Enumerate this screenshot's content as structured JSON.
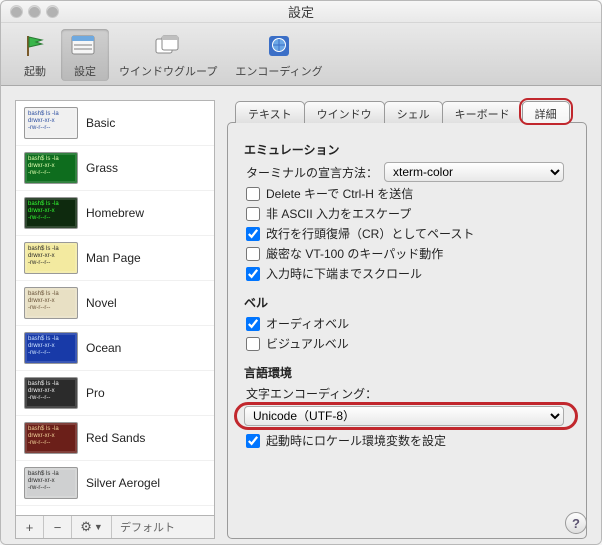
{
  "window": {
    "title": "設定"
  },
  "toolbar": {
    "items": [
      {
        "label": "起動"
      },
      {
        "label": "設定"
      },
      {
        "label": "ウインドウグループ"
      },
      {
        "label": "エンコーディング"
      }
    ]
  },
  "sidebar": {
    "profiles": [
      {
        "name": "Basic",
        "bg": "#f0f0f0",
        "fg": "#2d4fa0"
      },
      {
        "name": "Grass",
        "bg": "#0e6d1e",
        "fg": "#e0ffb0"
      },
      {
        "name": "Homebrew",
        "bg": "#0e2a0e",
        "fg": "#33ff33"
      },
      {
        "name": "Man Page",
        "bg": "#f3eaa0",
        "fg": "#2b2b2b"
      },
      {
        "name": "Novel",
        "bg": "#e8e0c4",
        "fg": "#6a543a"
      },
      {
        "name": "Ocean",
        "bg": "#183aa8",
        "fg": "#cde3ff"
      },
      {
        "name": "Pro",
        "bg": "#2b2b2b",
        "fg": "#eeeeee"
      },
      {
        "name": "Red Sands",
        "bg": "#6b1f19",
        "fg": "#f2d29a"
      },
      {
        "name": "Silver Aerogel",
        "bg": "#cfd0d1",
        "fg": "#2b2b2b"
      }
    ],
    "btn_add": "+",
    "btn_remove": "−",
    "btn_gear": "✿▾",
    "default_label": "デフォルト"
  },
  "tabs": {
    "items": [
      {
        "label": "テキスト"
      },
      {
        "label": "ウインドウ"
      },
      {
        "label": "シェル"
      },
      {
        "label": "キーボード"
      },
      {
        "label": "詳細"
      }
    ],
    "selected": 4
  },
  "panel": {
    "emulation": {
      "title": "エミュレーション",
      "declare_label": "ターミナルの宣言方法：",
      "declare_value": "xterm-color",
      "options": [
        {
          "label": "Delete キーで Ctrl-H を送信",
          "checked": false
        },
        {
          "label": "非 ASCII 入力をエスケープ",
          "checked": false
        },
        {
          "label": "改行を行頭復帰（CR）としてペースト",
          "checked": true
        },
        {
          "label": "厳密な VT-100 のキーパッド動作",
          "checked": false
        },
        {
          "label": "入力時に下端までスクロール",
          "checked": true
        }
      ]
    },
    "bell": {
      "title": "ベル",
      "options": [
        {
          "label": "オーディオベル",
          "checked": true
        },
        {
          "label": "ビジュアルベル",
          "checked": false
        }
      ]
    },
    "locale": {
      "title": "言語環境",
      "encoding_label": "文字エンコーディング：",
      "encoding_value": "Unicode（UTF-8）",
      "set_env": {
        "label": "起動時にロケール環境変数を設定",
        "checked": true
      }
    }
  },
  "help": "?"
}
